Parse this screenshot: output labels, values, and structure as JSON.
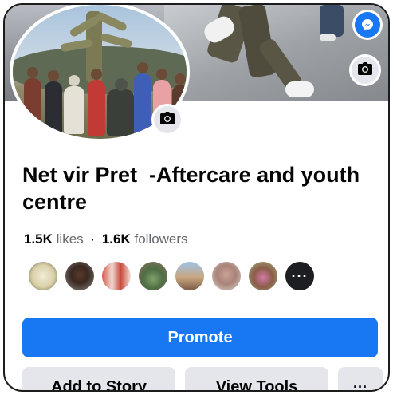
{
  "page": {
    "title": "Net vir Pret  -Aftercare and youth centre",
    "likes_count": "1.5K",
    "likes_label": "likes",
    "separator": "·",
    "followers_count": "1.6K",
    "followers_label": "followers"
  },
  "cover": {
    "badge_icon": "messenger-icon",
    "camera_icon": "camera-icon"
  },
  "profile": {
    "camera_icon": "camera-icon"
  },
  "friends": {
    "avatars": [
      "friend-1",
      "friend-2",
      "friend-3",
      "friend-4",
      "friend-5",
      "friend-6",
      "friend-7"
    ],
    "more_label": "···"
  },
  "actions": {
    "promote_label": "Promote",
    "add_story_label": "Add to Story",
    "view_tools_label": "View Tools",
    "more_label": "···"
  },
  "colors": {
    "brand_blue": "#1877f2",
    "secondary_button": "#e4e6eb",
    "text_primary": "#050505",
    "text_secondary": "#65676b"
  }
}
